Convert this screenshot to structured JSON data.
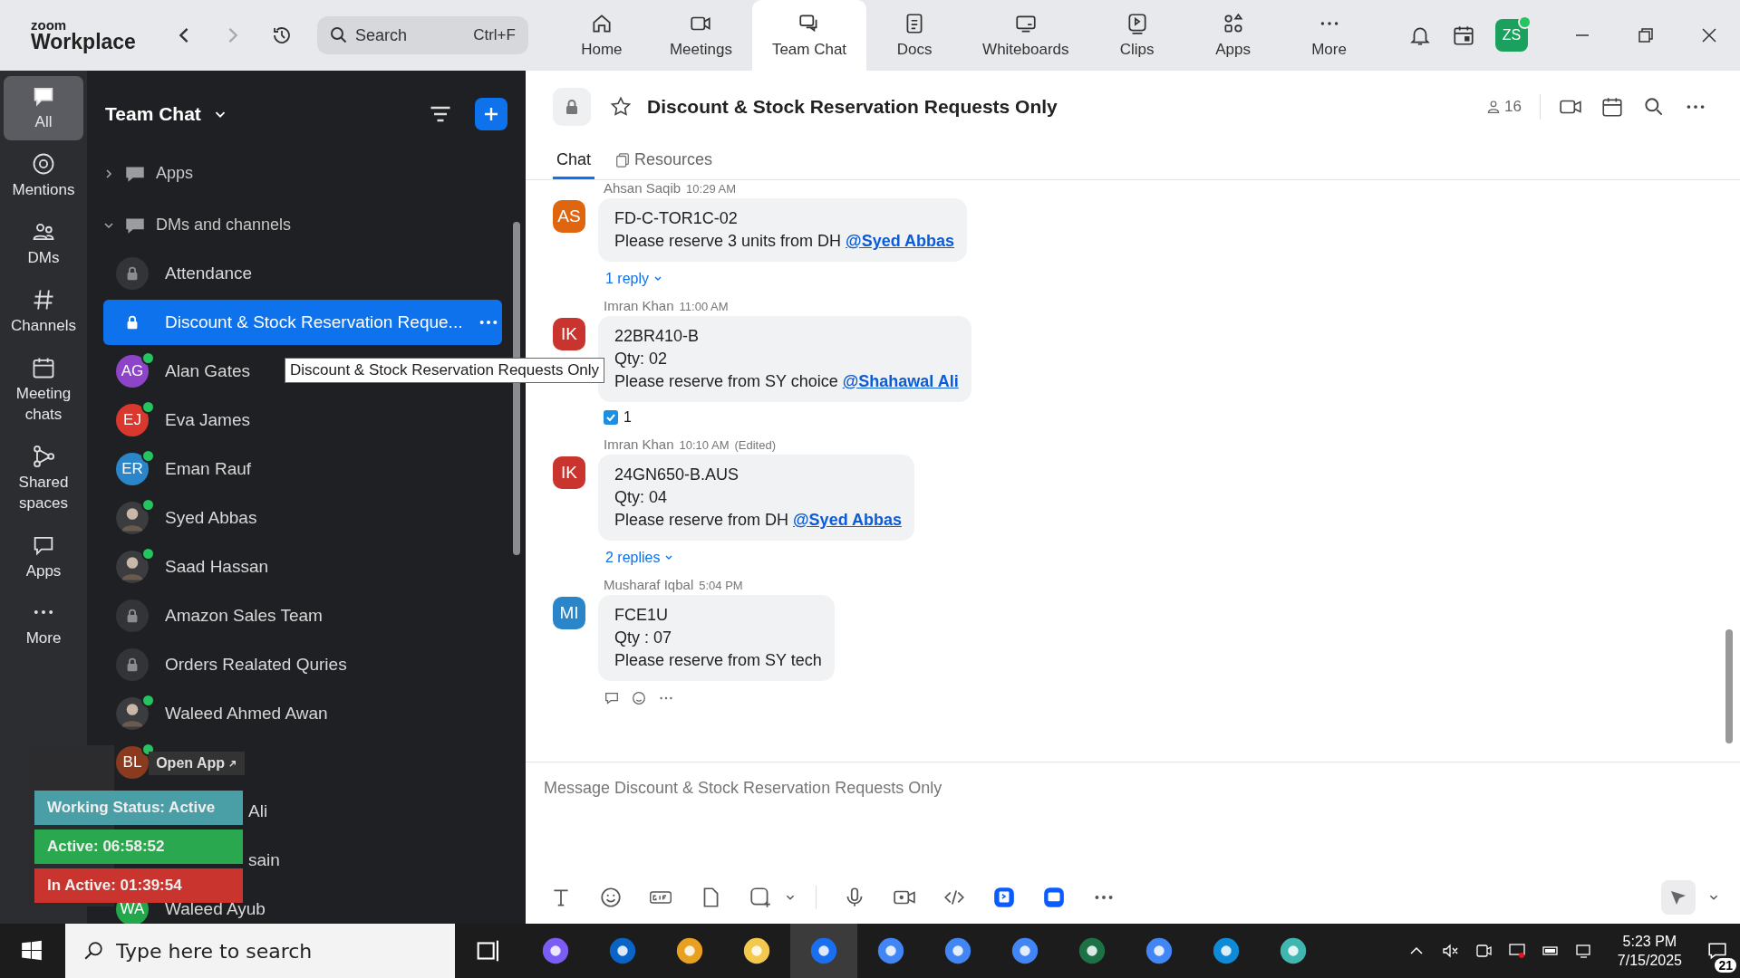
{
  "app": {
    "logo_top": "zoom",
    "logo_bottom": "Workplace",
    "search": {
      "placeholder": "Search",
      "shortcut": "Ctrl+F"
    }
  },
  "nav_tabs": [
    {
      "label": "Home",
      "selected": false
    },
    {
      "label": "Meetings",
      "selected": false
    },
    {
      "label": "Team Chat",
      "selected": true
    },
    {
      "label": "Docs",
      "selected": false
    },
    {
      "label": "Whiteboards",
      "selected": false
    },
    {
      "label": "Clips",
      "selected": false
    },
    {
      "label": "Apps",
      "selected": false
    },
    {
      "label": "More",
      "selected": false
    }
  ],
  "user": {
    "initials": "ZS",
    "online": true
  },
  "rail": [
    {
      "label": "All",
      "selected": true
    },
    {
      "label": "Mentions",
      "selected": false
    },
    {
      "label": "DMs",
      "selected": false
    },
    {
      "label": "Channels",
      "selected": false
    },
    {
      "label": "Meeting chats",
      "selected": false
    },
    {
      "label": "Shared spaces",
      "selected": false
    },
    {
      "label": "Apps",
      "selected": false
    },
    {
      "label": "More",
      "selected": false
    }
  ],
  "sidebar": {
    "title": "Team Chat",
    "sections": [
      {
        "label": "Apps",
        "expanded": false
      },
      {
        "label": "DMs and channels",
        "expanded": true
      }
    ],
    "items": [
      {
        "name": "Attendance",
        "kind": "channel",
        "selected": false
      },
      {
        "name": "Discount & Stock Reservation Reque...",
        "kind": "channel",
        "selected": true
      },
      {
        "name": "Alan Gates",
        "kind": "person",
        "initials": "AG",
        "color": "#8e44c9",
        "online": true,
        "selected": false
      },
      {
        "name": "Eva James",
        "kind": "person",
        "initials": "EJ",
        "color": "#d9382e",
        "online": true,
        "selected": false
      },
      {
        "name": "Eman Rauf",
        "kind": "person",
        "initials": "ER",
        "color": "#2a86c8",
        "online": true,
        "selected": false
      },
      {
        "name": "Syed Abbas",
        "kind": "photo",
        "online": true,
        "selected": false
      },
      {
        "name": "Saad Hassan",
        "kind": "photo",
        "online": true,
        "selected": false
      },
      {
        "name": "Amazon Sales Team",
        "kind": "channel",
        "selected": false
      },
      {
        "name": "Orders Realated Quries",
        "kind": "channel",
        "selected": false
      },
      {
        "name": "Waleed Ahmed Awan",
        "kind": "photo",
        "online": true,
        "selected": false
      },
      {
        "kind": "person",
        "initials": "BL",
        "color": "#8a3a1e",
        "online": true,
        "selected": false
      },
      {
        "name": "Ali",
        "kind": "partial",
        "selected": false
      },
      {
        "name": "sain",
        "kind": "partial",
        "selected": false
      },
      {
        "name": "Waleed Ayub",
        "kind": "person",
        "initials": "WA",
        "color": "#22a84a",
        "selected": false
      }
    ]
  },
  "tooltip": "Discount & Stock Reservation Requests Only",
  "status_widget": {
    "open_app": "Open App",
    "bars": [
      {
        "text": "Working Status: Active",
        "color": "#4a9ea6"
      },
      {
        "text": "Active: 06:58:52",
        "color": "#2aa84f"
      },
      {
        "text": "In Active: 01:39:54",
        "color": "#c9352e"
      }
    ]
  },
  "chat": {
    "title": "Discount & Stock Reservation Requests Only",
    "members": "16",
    "tabs": [
      {
        "label": "Chat",
        "selected": true
      },
      {
        "label": "Resources",
        "selected": false
      }
    ],
    "messages": [
      {
        "sender": "Ahsan Saqib",
        "time": "10:29 AM",
        "initials": "AS",
        "color": "#e0650f",
        "lines": [
          {
            "text": "FD-C-TOR1C-02"
          },
          {
            "text": "Please reserve 3 units from DH ",
            "mention": "@Syed Abbas"
          }
        ],
        "replies": "1 reply"
      },
      {
        "sender": "Imran Khan",
        "time": "11:00 AM",
        "initials": "IK",
        "color": "#c9352e",
        "lines": [
          {
            "text": "22BR410-B"
          },
          {
            "text": "Qty: 02"
          },
          {
            "text": "Please reserve from SY choice ",
            "mention": "@Shahawal Ali"
          }
        ],
        "reaction": "1"
      },
      {
        "sender": "Imran Khan",
        "time": "10:10 AM",
        "edited": "(Edited)",
        "initials": "IK",
        "color": "#c9352e",
        "lines": [
          {
            "text": "24GN650-B.AUS"
          },
          {
            "text": "Qty: 04"
          },
          {
            "text": "Please reserve from DH ",
            "mention": "@Syed Abbas"
          }
        ],
        "replies": "2 replies"
      },
      {
        "sender": "Musharaf Iqbal",
        "time": "5:04 PM",
        "initials": "MI",
        "color": "#2a86c8",
        "lines": [
          {
            "text": "FCE1U"
          },
          {
            "text": "Qty : 07"
          },
          {
            "text": "Please reserve from SY tech"
          }
        ],
        "actions": true
      }
    ],
    "composer": {
      "placeholder": "Message Discount & Stock Reservation Requests Only"
    }
  },
  "taskbar": {
    "search": {
      "placeholder": "Type here to search"
    },
    "time": "5:23 PM",
    "date": "7/15/2025",
    "notifications": "21"
  }
}
